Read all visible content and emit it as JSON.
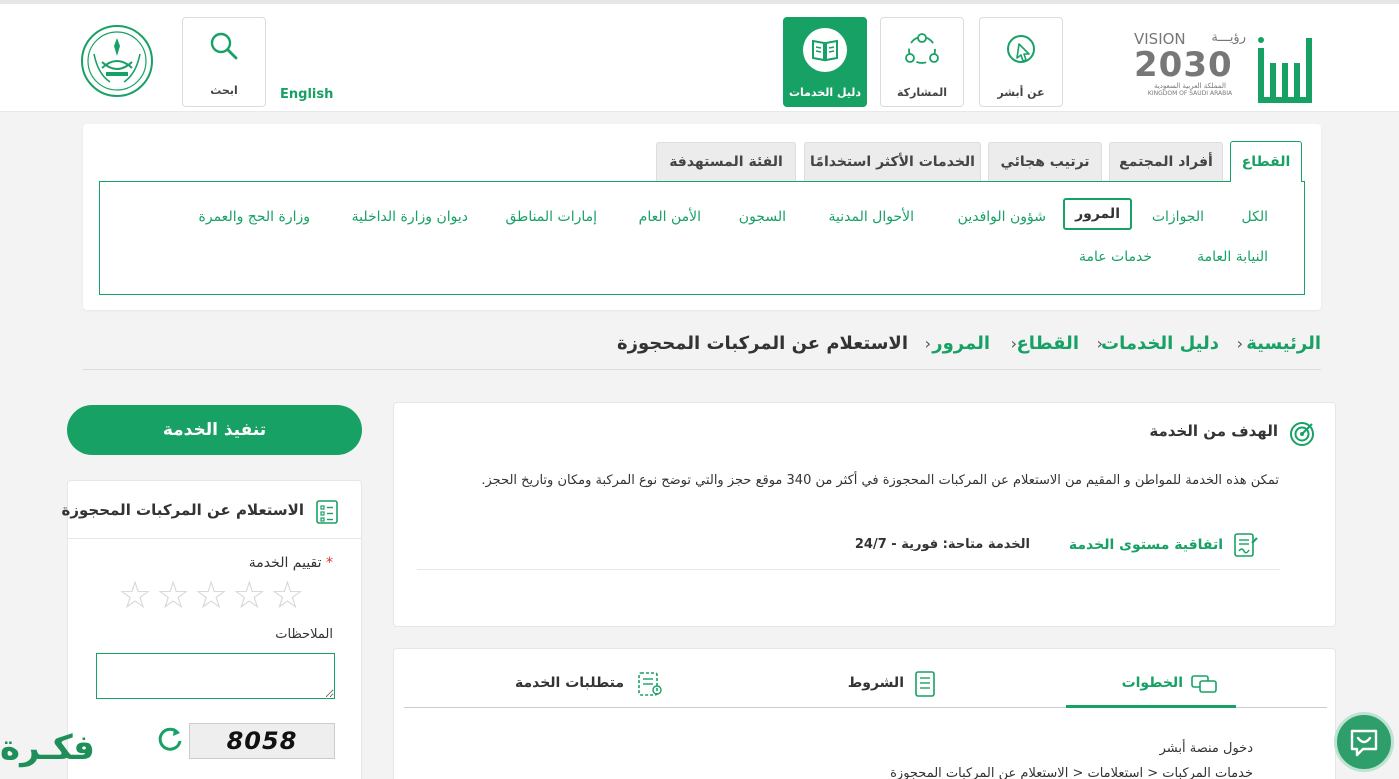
{
  "header": {
    "logo_text": "أبشر",
    "vision_label": "VISION",
    "vision_ar": "رؤيـــة",
    "vision_year": "2030",
    "kingdom_ar": "المملكة العربية السعودية",
    "kingdom_en": "KINGDOM OF SAUDI ARABIA",
    "tiles": {
      "about": "عن أبشر",
      "participation": "المشاركة",
      "guide": "دليل الخدمات"
    },
    "english_link": "English",
    "search_label": "ابحث"
  },
  "sector_tabs": [
    "القطاع",
    "أفراد المجتمع",
    "ترتيب هجائي",
    "الخدمات الأكثر استخدامًا",
    "الفئة المستهدفة"
  ],
  "sector_items_row1": [
    "الكل",
    "الجوازات",
    "المرور",
    "شؤون الوافدين",
    "الأحوال المدنية",
    "السجون",
    "الأمن العام",
    "إمارات المناطق",
    "ديوان وزارة الداخلية",
    "وزارة الحج والعمرة"
  ],
  "sector_items_row2": [
    "النيابة العامة",
    "خدمات عامة"
  ],
  "breadcrumb": {
    "home": "الرئيسية",
    "guide": "دليل الخدمات",
    "sector": "القطاع",
    "traffic": "المرور",
    "current": "الاستعلام عن المركبات المحجوزة",
    "separator": "›"
  },
  "sidebar": {
    "execute_button": "تنفيذ الخدمة",
    "card_title": "الاستعلام عن المركبات المحجوزة",
    "rating_label": "تقييم الخدمة",
    "required_mark": "*",
    "notes_label": "الملاحظات",
    "captcha_text": "8058",
    "star": "☆"
  },
  "goal": {
    "title": "الهدف من الخدمة",
    "description": "تمكن هذه الخدمة للمواطن و المقيم من الاستعلام عن المركبات المحجوزة في أكثر من 340 موقع حجز والتي توضح نوع المركبة ومكان وتاريخ الحجز.",
    "sla": "اتفاقية مستوى الخدمة",
    "availability": "الخدمة متاحة: فورية - 24/7"
  },
  "steps_tabs": {
    "steps": "الخطوات",
    "terms": "الشروط",
    "requirements": "متطلبات الخدمة"
  },
  "steps": [
    "دخول منصة أبشر",
    "خدمات المركبات < استعلامات < الاستعلام عن المركبات المحجوزة"
  ],
  "watermark": "فكـرة",
  "colors": {
    "accent": "#18a165",
    "background": "#f3f3f3"
  }
}
